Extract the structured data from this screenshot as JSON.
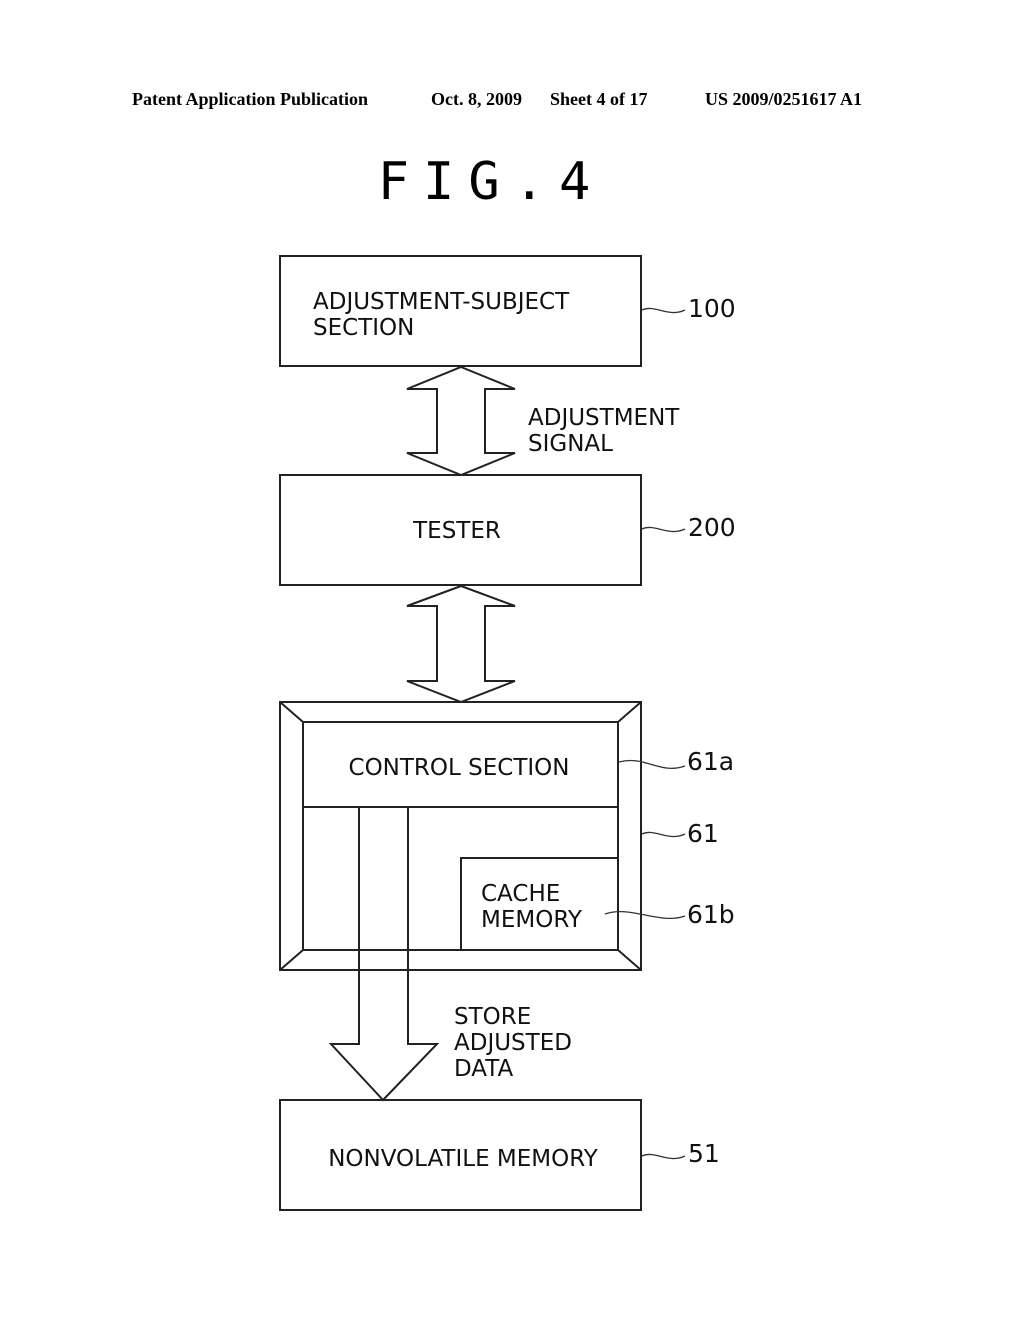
{
  "header": {
    "publication": "Patent Application Publication",
    "date": "Oct. 8, 2009",
    "sheet": "Sheet 4 of 17",
    "number": "US 2009/0251617 A1"
  },
  "figure": {
    "title": "FIG.4",
    "blocks": {
      "adjustment_subject": {
        "line1": "ADJUSTMENT-SUBJECT",
        "line2": "SECTION",
        "ref": "100"
      },
      "tester": {
        "label": "TESTER",
        "ref": "200"
      },
      "module": {
        "ref": "61"
      },
      "control_section": {
        "label": "CONTROL SECTION",
        "ref": "61a"
      },
      "cache_memory": {
        "line1": "CACHE",
        "line2": "MEMORY",
        "ref": "61b"
      },
      "nonvolatile_memory": {
        "label": "NONVOLATILE MEMORY",
        "ref": "51"
      }
    },
    "arrows": {
      "adjustment_signal": {
        "line1": "ADJUSTMENT",
        "line2": "SIGNAL"
      },
      "store": {
        "line1": "STORE",
        "line2": "ADJUSTED",
        "line3": "DATA"
      }
    }
  }
}
